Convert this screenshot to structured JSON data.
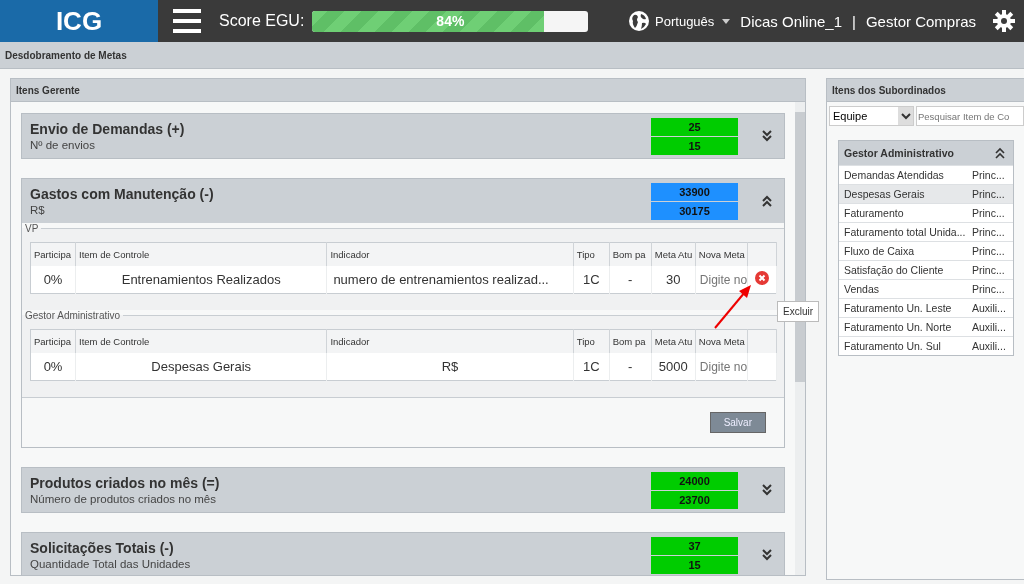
{
  "header": {
    "logo": "ICG",
    "score_label": "Score EGU:",
    "score": {
      "level": 0.84,
      "reading": "84%"
    },
    "language": "Português",
    "user": "Dicas Online_1",
    "separator": "|",
    "role": "Gestor Compras"
  },
  "breadcrumb": "Desdobramento de Metas",
  "manager_panel": {
    "title": "Itens Gerente",
    "items": [
      {
        "title": "Envio de Demandas (+)",
        "subtitle": "Nº de envios",
        "color": "#00cc00",
        "values": [
          "25",
          "15"
        ],
        "expanded": false
      },
      {
        "title": "Gastos com Manutenção (-)",
        "subtitle": "R$",
        "color": "#1e90ff",
        "values": [
          "33900",
          "30175"
        ],
        "expanded": true,
        "groups": [
          {
            "legend": "VP",
            "columns": [
              "Participa",
              "Item de Controle",
              "Indicador",
              "Tipo",
              "Bom pa",
              "Meta Atu",
              "Nova Meta"
            ],
            "rows": [
              {
                "share": "0%",
                "item": "Entrenamientos Realizados",
                "indicator": "numero de entrenamientos realizad...",
                "type": "1C",
                "good": "-",
                "current": "30",
                "placeholder": "Digite no",
                "deletable": true
              }
            ]
          },
          {
            "legend": "Gestor Administrativo",
            "columns": [
              "Participa",
              "Item de Controle",
              "Indicador",
              "Tipo",
              "Bom pa",
              "Meta Atu",
              "Nova Meta"
            ],
            "rows": [
              {
                "share": "0%",
                "item": "Despesas Gerais",
                "indicator": "R$",
                "type": "1C",
                "good": "-",
                "current": "5000",
                "placeholder": "Digite no",
                "deletable": false
              }
            ]
          }
        ],
        "save": "Salvar"
      },
      {
        "title": "Produtos criados no mês (=)",
        "subtitle": "Número de produtos criados no mês",
        "color": "#00cc00",
        "values": [
          "24000",
          "23700"
        ],
        "expanded": false
      },
      {
        "title": "Solicitações Totais (-)",
        "subtitle": "Quantidade Total das Unidades",
        "color": "#00cc00",
        "values": [
          "37",
          "15"
        ],
        "expanded": false
      }
    ]
  },
  "tooltip": "Excluir",
  "subordinates_panel": {
    "title": "Itens dos Subordinados",
    "filter": "Equipe",
    "search_placeholder": "Pesquisar Item de Co",
    "group": {
      "title": "Gestor Administrativo",
      "expanded": true,
      "items": [
        {
          "name": "Demandas Atendidas",
          "type": "Princ...",
          "selected": false
        },
        {
          "name": "Despesas Gerais",
          "type": "Princ...",
          "selected": true
        },
        {
          "name": "Faturamento",
          "type": "Princ...",
          "selected": false
        },
        {
          "name": "Faturamento total Unida...",
          "type": "Princ...",
          "selected": false
        },
        {
          "name": "Fluxo de Caixa",
          "type": "Princ...",
          "selected": false
        },
        {
          "name": "Satisfação do Cliente",
          "type": "Princ...",
          "selected": false
        },
        {
          "name": "Vendas",
          "type": "Princ...",
          "selected": false
        },
        {
          "name": "Faturamento Un. Leste",
          "type": "Auxili...",
          "selected": false
        },
        {
          "name": "Faturamento Un. Norte",
          "type": "Auxili...",
          "selected": false
        },
        {
          "name": "Faturamento Un. Sul",
          "type": "Auxili...",
          "selected": false
        }
      ]
    }
  }
}
